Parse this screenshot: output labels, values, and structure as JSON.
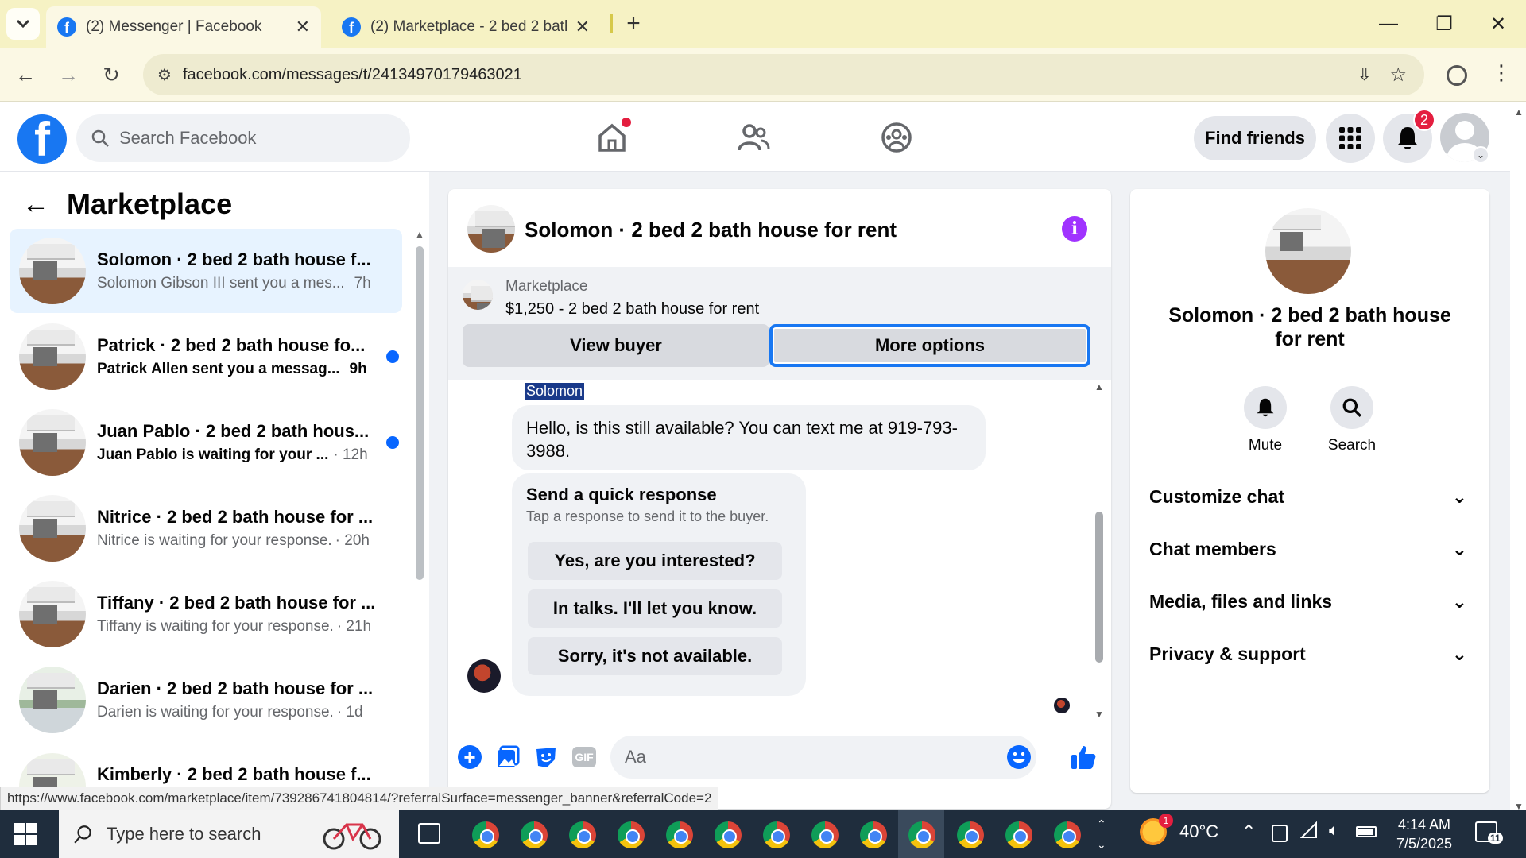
{
  "browser": {
    "tabs": [
      {
        "title": "(2) Messenger | Facebook",
        "active": true
      },
      {
        "title": "(2) Marketplace - 2 bed 2 bath h",
        "active": false
      }
    ],
    "url": "facebook.com/messages/t/24134970179463021",
    "status_url": "https://www.facebook.com/marketplace/item/739286741804814/?referralSurface=messenger_banner&referralCode=2"
  },
  "header": {
    "logo": "f",
    "search_placeholder": "Search Facebook",
    "find_friends": "Find friends",
    "notification_count": "2"
  },
  "sidebar": {
    "title": "Marketplace",
    "conversations": [
      {
        "name": "Solomon · 2 bed 2 bath house f...",
        "preview": "Solomon Gibson III sent you a mes...",
        "time": "7h",
        "unread": false,
        "selected": true
      },
      {
        "name": "Patrick · 2 bed 2 bath house fo...",
        "preview": "Patrick Allen sent you a messag...",
        "time": "9h",
        "unread": true,
        "selected": false
      },
      {
        "name": "Juan Pablo · 2 bed 2 bath hous...",
        "preview": "Juan Pablo is waiting for your ...",
        "time": "· 12h",
        "unread": true,
        "selected": false
      },
      {
        "name": "Nitrice · 2 bed 2 bath house for ...",
        "preview": "Nitrice is waiting for your response.",
        "time": "· 20h",
        "unread": false,
        "selected": false
      },
      {
        "name": "Tiffany · 2 bed 2 bath house for ...",
        "preview": "Tiffany is waiting for your response.",
        "time": "· 21h",
        "unread": false,
        "selected": false
      },
      {
        "name": "Darien · 2 bed 2 bath house for ...",
        "preview": "Darien is waiting for your response.",
        "time": "· 1d",
        "unread": false,
        "selected": false
      },
      {
        "name": "Kimberly · 2 bed 2 bath house f...",
        "preview": "",
        "time": "",
        "unread": false,
        "selected": false
      }
    ]
  },
  "chat": {
    "title": "Solomon · 2 bed 2 bath house for rent",
    "marketplace_label": "Marketplace",
    "listing": "$1,250 - 2 bed 2 bath house for rent",
    "view_buyer": "View buyer",
    "more_options": "More options",
    "sender": "Solomon",
    "message": "Hello, is this still available? You can text me at 919-793-3988.",
    "quick_title": "Send a quick response",
    "quick_sub": "Tap a response to send it to the buyer.",
    "quick_replies": [
      "Yes, are you interested?",
      "In talks. I'll let you know.",
      "Sorry, it's not available."
    ],
    "composer_placeholder": "Aa"
  },
  "info_panel": {
    "name": "Solomon · 2 bed 2 bath house for rent",
    "mute": "Mute",
    "search": "Search",
    "sections": [
      "Customize chat",
      "Chat members",
      "Media, files and links",
      "Privacy & support"
    ]
  },
  "taskbar": {
    "search_placeholder": "Type here to search",
    "temperature": "40°C",
    "weather_badge": "1",
    "time": "4:14 AM",
    "date": "7/5/2025",
    "notification_count": "11"
  },
  "colors": {
    "brand": "#1877f2",
    "unread_dot": "#0866ff",
    "info_icon": "#a033ff",
    "badge": "#e41e3f"
  }
}
